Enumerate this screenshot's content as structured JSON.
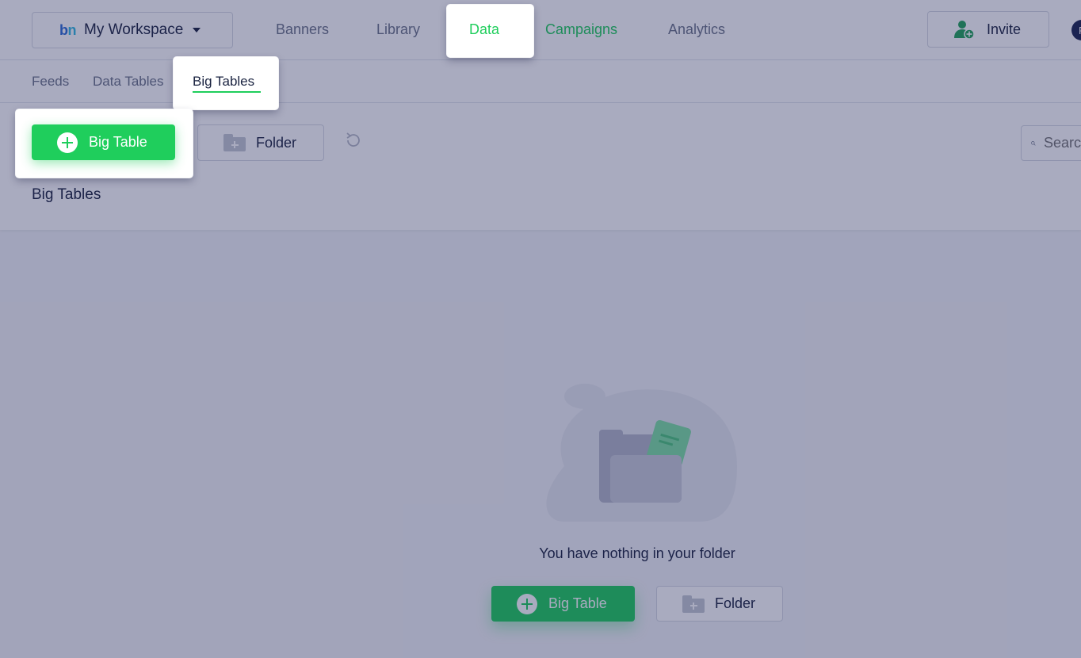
{
  "workspace": {
    "logo_b": "b",
    "logo_n": "n",
    "name": "My Workspace"
  },
  "nav": {
    "items": [
      {
        "label": "Banners"
      },
      {
        "label": "Library"
      },
      {
        "label": "Data"
      },
      {
        "label": "Campaigns"
      },
      {
        "label": "Analytics"
      }
    ],
    "active": "Data"
  },
  "invite": {
    "label": "Invite",
    "icon": "user-add-icon"
  },
  "avatar": {
    "initial": "F"
  },
  "subtabs": {
    "items": [
      {
        "label": "Feeds"
      },
      {
        "label": "Data Tables"
      },
      {
        "label": "Big Tables"
      }
    ],
    "active": "Big Tables"
  },
  "toolbar": {
    "new_big_table_label": "Big Table",
    "new_folder_label": "Folder",
    "search_placeholder": "Search"
  },
  "section": {
    "title": "Big Tables"
  },
  "empty_state": {
    "message": "You have nothing in your folder",
    "big_table_label": "Big Table",
    "folder_label": "Folder"
  },
  "colors": {
    "accent": "#1fce5c",
    "overlay": "rgba(29,35,86,0.38)",
    "text": "#1a2340",
    "muted": "#6b7388"
  }
}
